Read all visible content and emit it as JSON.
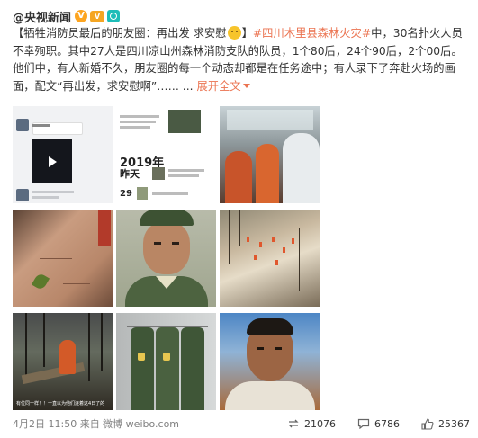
{
  "post": {
    "author": "@央视新闻",
    "badges": {
      "verified": "V",
      "hot": "V",
      "channel": ""
    },
    "text_part1": "【牺牲消防员最后的朋友圈：再出发 求安慰",
    "text_part2": "】",
    "topic": "#四川木里县森林火灾#",
    "text_part3": "中，30名扑火人员不幸殉职。其中27人是四川凉山州森林消防支队的队员，1个80后，24个90后，2个00后。他们中，有人新婚不久，朋友圈的每一个动态却都是在任务途中；有人录下了奔赴火场的画面，配文“再出发，求安慰啊”…… ...",
    "expand_label": "展开全文",
    "images": [
      {
        "name": "chat-screenshot"
      },
      {
        "name": "moments-2019"
      },
      {
        "name": "truck-interior"
      },
      {
        "name": "hands"
      },
      {
        "name": "soldier-portrait"
      },
      {
        "name": "hillside-firefighters"
      },
      {
        "name": "burnt-forest"
      },
      {
        "name": "wardrobe-uniforms"
      },
      {
        "name": "selfie"
      }
    ],
    "image_texts": {
      "chat_name": "黄飞飞",
      "year": "2019年",
      "yesterday": "昨天",
      "day": "29",
      "caption": "有位同一样！！一直以为他们连着这4日了的"
    },
    "meta": "4月2日 11:50 来自 微博 weibo.com",
    "actions": {
      "repost_count": "21076",
      "comment_count": "6786",
      "like_count": "25367"
    }
  },
  "colors": {
    "accent": "#eb7350",
    "text": "#333333",
    "meta": "#808080"
  }
}
